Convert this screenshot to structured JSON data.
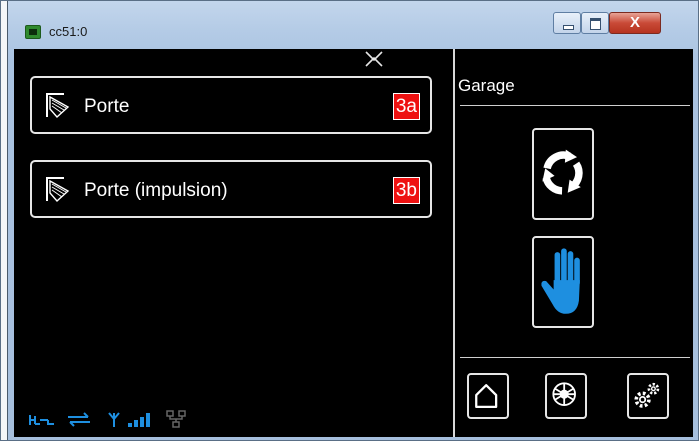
{
  "window": {
    "title": "cc51:0",
    "close_glyph": "X"
  },
  "devices": [
    {
      "label": "Porte",
      "badge": "3a",
      "icon": "garage-door-icon"
    },
    {
      "label": "Porte (impulsion)",
      "badge": "3b",
      "icon": "garage-door-icon"
    }
  ],
  "room": {
    "title": "Garage",
    "actions": [
      {
        "icon": "refresh-icon"
      },
      {
        "icon": "stop-hand-icon"
      }
    ]
  },
  "nav": [
    {
      "icon": "home-icon"
    },
    {
      "icon": "radar-icon"
    },
    {
      "icon": "settings-gears-icon"
    }
  ],
  "status_icons": [
    "network-link-icon",
    "sync-arrows-icon",
    "antenna-icon",
    "signal-bars-icon",
    "lan-icon"
  ],
  "colors": {
    "background": "#000000",
    "accent_blue": "#1e8fe0",
    "badge_red": "#ee1111",
    "border": "#e6e6e6"
  }
}
